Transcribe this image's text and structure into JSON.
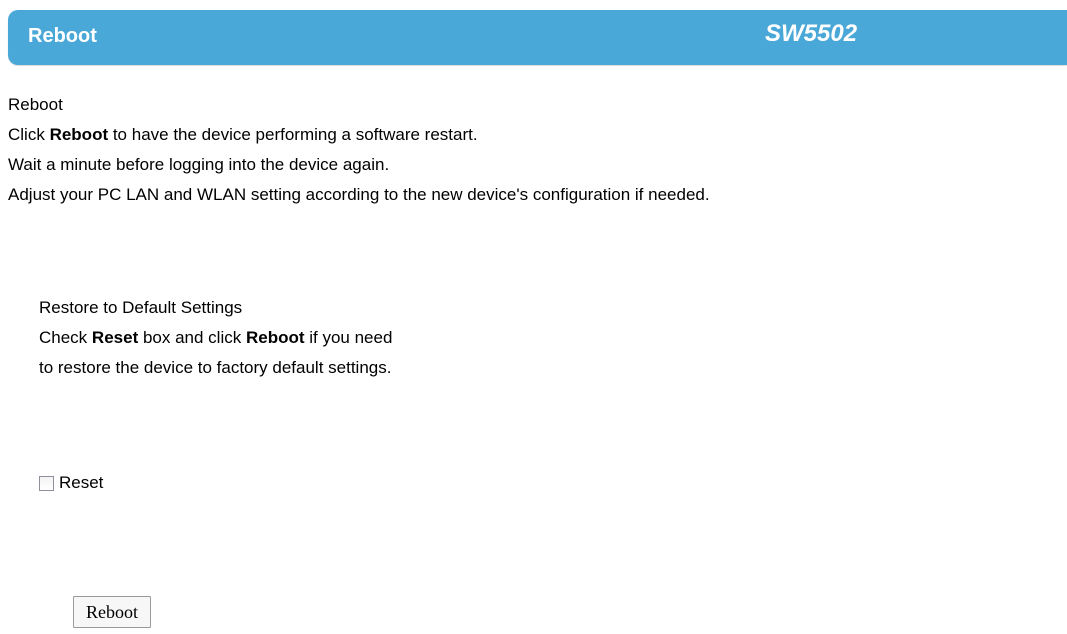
{
  "header": {
    "title": "Reboot",
    "device_name": "SW5502"
  },
  "reboot_section": {
    "heading": "Reboot",
    "line1_prefix": "Click ",
    "line1_bold": "Reboot",
    "line1_suffix": " to have the device performing a software restart.",
    "line2": "Wait a minute before logging into the device again.",
    "line3": "Adjust your PC LAN and WLAN setting according to the new device's configuration if needed."
  },
  "restore_section": {
    "heading": "Restore to Default Settings",
    "line1_prefix": "Check ",
    "line1_bold1": "Reset",
    "line1_middle": " box and click ",
    "line1_bold2": "Reboot",
    "line1_suffix": " if you need",
    "line2": "to restore the device to factory default settings."
  },
  "reset_checkbox": {
    "label": "Reset",
    "checked": false
  },
  "reboot_button": {
    "label": "Reboot"
  },
  "colors": {
    "header_bg": "#4aa8d8",
    "header_text": "#ffffff"
  }
}
